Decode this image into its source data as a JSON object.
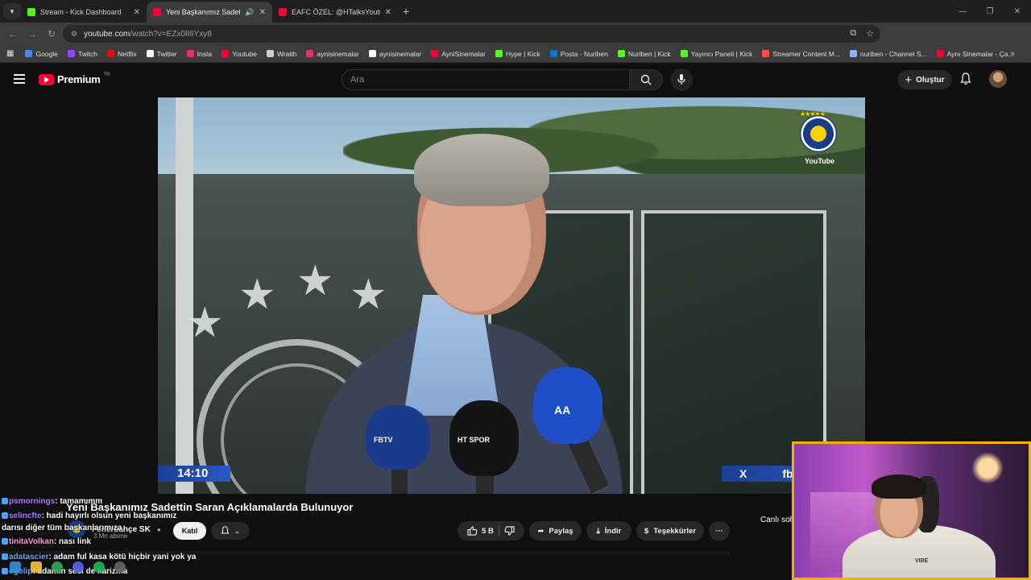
{
  "browser": {
    "tabs": [
      {
        "title": "Stream - Kick Dashboard",
        "color": "#53fc18"
      },
      {
        "title": "Yeni Başkanımız Sadettin Saran",
        "color": "#ff0033"
      },
      {
        "title": "EAFC ÖZEL: @HTalksYoutube, @",
        "color": "#ff0033"
      }
    ],
    "url_host": "youtube.com",
    "url_path": "/watch?v=EZx0lI6Yxy8",
    "bookmarks": [
      {
        "label": "Google",
        "color": "#4285f4"
      },
      {
        "label": "Twitch",
        "color": "#9146ff"
      },
      {
        "label": "Netflix",
        "color": "#e50914"
      },
      {
        "label": "Twitter",
        "color": "#ffffff"
      },
      {
        "label": "Insta",
        "color": "#e1306c"
      },
      {
        "label": "Youtube",
        "color": "#ff0033"
      },
      {
        "label": "Wraith",
        "color": "#cccccc"
      },
      {
        "label": "aynisinemalar",
        "color": "#e1306c"
      },
      {
        "label": "aynisinemalar",
        "color": "#ffffff"
      },
      {
        "label": "AyniSinemalar",
        "color": "#ff0033"
      },
      {
        "label": "Hype | Kick",
        "color": "#53fc18"
      },
      {
        "label": "Posta - Nuriben",
        "color": "#0078d4"
      },
      {
        "label": "Nuriben | Kick",
        "color": "#53fc18"
      },
      {
        "label": "Yayıncı Paneli | Kick",
        "color": "#53fc18"
      },
      {
        "label": "Streamer Content M...",
        "color": "#ff4d4d"
      },
      {
        "label": "nuriben - Channel S...",
        "color": "#8ab4f8"
      },
      {
        "label": "Aynı Sinemalar - Ça...",
        "color": "#ff0033"
      }
    ]
  },
  "youtube": {
    "logo_text": "Premium",
    "logo_tr": "TR",
    "search_placeholder": "Ara",
    "create_label": "Oluştur"
  },
  "video": {
    "clock": "14:10",
    "fb": "fb",
    "x_logo": "X",
    "overlay_logo_text": "YouTube",
    "mic_labels": [
      "FBTV",
      "HT SPOR",
      "AA"
    ],
    "title": "Yeni Başkanımız Sadettin Saran Açıklamalarda Bulunuyor",
    "channel_name": "Fenerbahçe SK",
    "channel_subs": "3 Mn abone",
    "join_label": "Katıl",
    "likes": "5 B",
    "share_label": "Paylaş",
    "download_label": "İndir",
    "thanks_label": "Teşekkürler",
    "live_chat_label": "Canlı soh"
  },
  "chat": [
    {
      "user": "psmornings",
      "user_color": "#b07cff",
      "text": ": tamamımm"
    },
    {
      "user": "selincfte",
      "user_color": "#b07cff",
      "text": ": hadi hayırlı olsun yeni başkanımız"
    },
    {
      "user": "",
      "user_color": "#ffffff",
      "text": "darısı diğer tüm başkanlarımıza"
    },
    {
      "user": "tinitaVolkan",
      "user_color": "#ff9ad5",
      "text": ": nası link"
    },
    {
      "user": "adatascier",
      "user_color": "#5aa9ff",
      "text": ": adam ful kasa kötü hiçbir yani yok ya"
    },
    {
      "user": "cgolip",
      "user_color": "#5aa9ff",
      "text": ": adamın sesi de karizma"
    }
  ],
  "webcam": {
    "shirt_text": "VIBE"
  },
  "colors": {
    "accent": "#ff0033",
    "cam_border": "#f2b100",
    "kick": "#53fc18"
  }
}
